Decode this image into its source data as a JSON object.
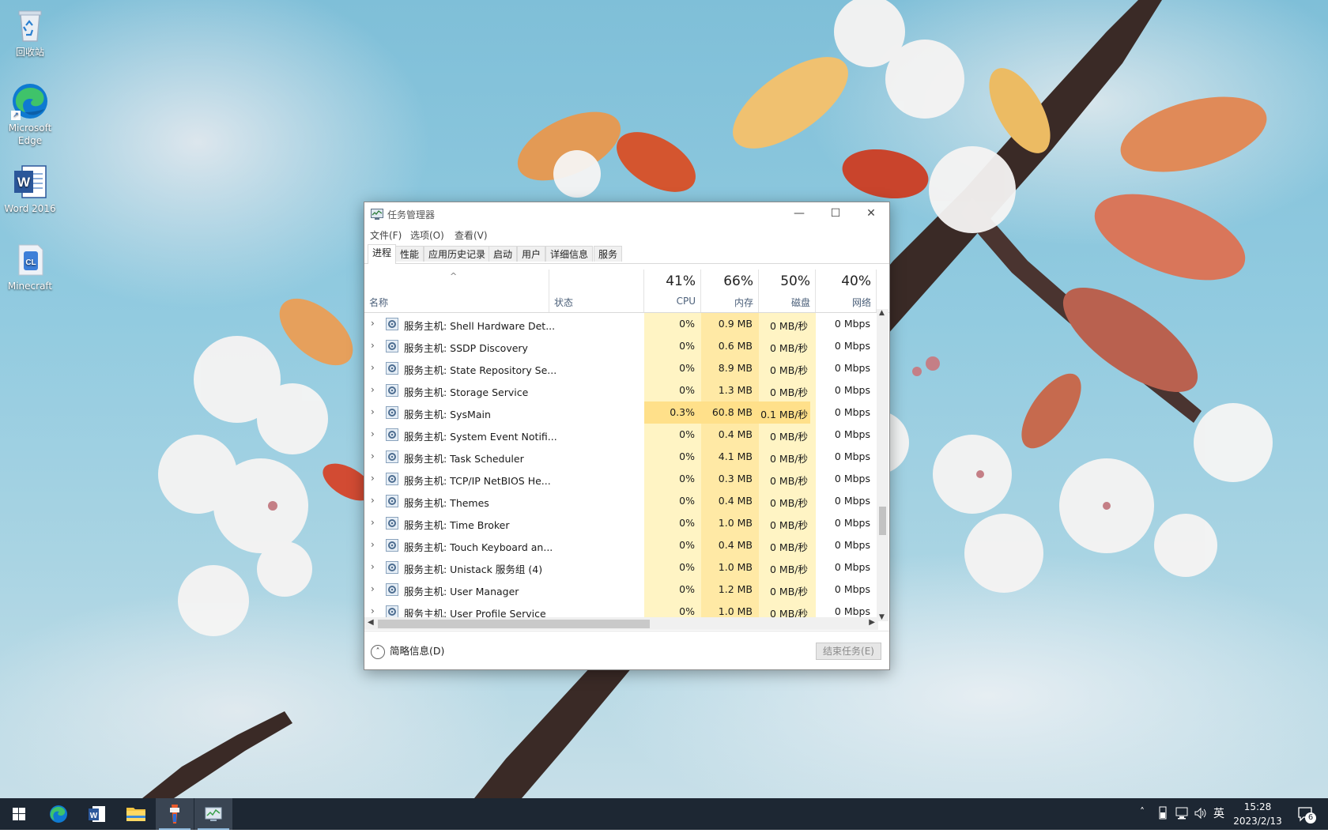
{
  "desktop": {
    "icons": [
      {
        "label": "回收站"
      },
      {
        "label": "Microsoft Edge"
      },
      {
        "label": "Word 2016"
      },
      {
        "label": "Minecraft"
      }
    ]
  },
  "task_manager": {
    "title": "任务管理器",
    "window_controls": {
      "minimize": "—",
      "maximize": "☐",
      "close": "✕"
    },
    "menu": [
      "文件(F)",
      "选项(O)",
      "查看(V)"
    ],
    "tabs": [
      "进程",
      "性能",
      "应用历史记录",
      "启动",
      "用户",
      "详细信息",
      "服务"
    ],
    "active_tab": "进程",
    "columns": {
      "name": "名称",
      "status": "状态",
      "cpu": {
        "percent": "41%",
        "label": "CPU"
      },
      "memory": {
        "percent": "66%",
        "label": "内存"
      },
      "disk": {
        "percent": "50%",
        "label": "磁盘"
      },
      "network": {
        "percent": "40%",
        "label": "网络"
      }
    },
    "rows": [
      {
        "name": "服务主机: Shell Hardware Det...",
        "cpu": "0%",
        "memory": "0.9 MB",
        "disk": "0 MB/秒",
        "network": "0 Mbps"
      },
      {
        "name": "服务主机: SSDP Discovery",
        "cpu": "0%",
        "memory": "0.6 MB",
        "disk": "0 MB/秒",
        "network": "0 Mbps"
      },
      {
        "name": "服务主机: State Repository Se...",
        "cpu": "0%",
        "memory": "8.9 MB",
        "disk": "0 MB/秒",
        "network": "0 Mbps"
      },
      {
        "name": "服务主机: Storage Service",
        "cpu": "0%",
        "memory": "1.3 MB",
        "disk": "0 MB/秒",
        "network": "0 Mbps"
      },
      {
        "name": "服务主机: SysMain",
        "cpu": "0.3%",
        "memory": "60.8 MB",
        "disk": "0.1 MB/秒",
        "network": "0 Mbps"
      },
      {
        "name": "服务主机: System Event Notifi...",
        "cpu": "0%",
        "memory": "0.4 MB",
        "disk": "0 MB/秒",
        "network": "0 Mbps"
      },
      {
        "name": "服务主机: Task Scheduler",
        "cpu": "0%",
        "memory": "4.1 MB",
        "disk": "0 MB/秒",
        "network": "0 Mbps"
      },
      {
        "name": "服务主机: TCP/IP NetBIOS He...",
        "cpu": "0%",
        "memory": "0.3 MB",
        "disk": "0 MB/秒",
        "network": "0 Mbps"
      },
      {
        "name": "服务主机: Themes",
        "cpu": "0%",
        "memory": "0.4 MB",
        "disk": "0 MB/秒",
        "network": "0 Mbps"
      },
      {
        "name": "服务主机: Time Broker",
        "cpu": "0%",
        "memory": "1.0 MB",
        "disk": "0 MB/秒",
        "network": "0 Mbps"
      },
      {
        "name": "服务主机: Touch Keyboard an...",
        "cpu": "0%",
        "memory": "0.4 MB",
        "disk": "0 MB/秒",
        "network": "0 Mbps"
      },
      {
        "name": "服务主机: Unistack 服务组 (4)",
        "cpu": "0%",
        "memory": "1.0 MB",
        "disk": "0 MB/秒",
        "network": "0 Mbps"
      },
      {
        "name": "服务主机: User Manager",
        "cpu": "0%",
        "memory": "1.2 MB",
        "disk": "0 MB/秒",
        "network": "0 Mbps"
      },
      {
        "name": "服务主机: User Profile Service",
        "cpu": "0%",
        "memory": "1.0 MB",
        "disk": "0 MB/秒",
        "network": "0 Mbps"
      }
    ],
    "footer": {
      "fewer_details": "简略信息(D)",
      "end_task": "结束任务(E)"
    }
  },
  "taskbar": {
    "tray": {
      "ime": "英",
      "notification_count": "6"
    },
    "clock": {
      "time": "15:28",
      "date": "2023/2/13"
    }
  },
  "colors": {
    "taskbar_bg": "#1d2733",
    "usage_light": "#fff4c4",
    "usage_dark": "#ffe9a5",
    "header_label": "#4c607a"
  }
}
